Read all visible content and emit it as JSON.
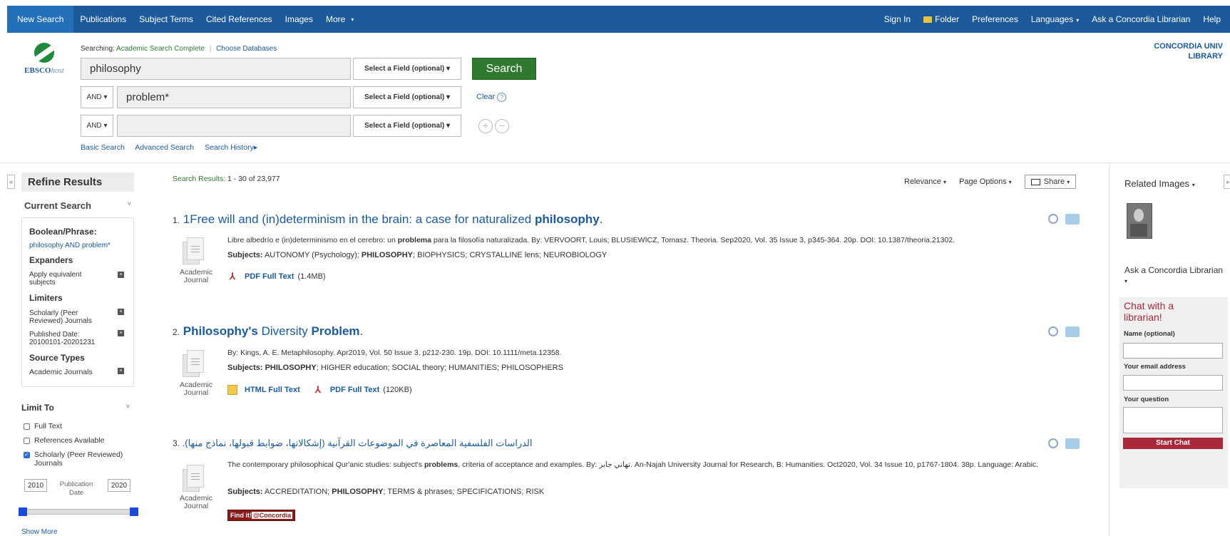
{
  "topnav": {
    "left": [
      "New Search",
      "Publications",
      "Subject Terms",
      "Cited References",
      "Images",
      "More"
    ],
    "right": {
      "sign_in": "Sign In",
      "folder": "Folder",
      "preferences": "Preferences",
      "languages": "Languages",
      "ask": "Ask a Concordia Librarian",
      "help": "Help"
    }
  },
  "logo": {
    "brand": "EBSCO",
    "suffix": "host"
  },
  "search": {
    "searching_label": "Searching:",
    "database": "Academic Search Complete",
    "choose_db": "Choose Databases",
    "q1": "philosophy",
    "q2": "problem*",
    "q3": "",
    "bool2": "AND",
    "bool3": "AND",
    "field": "Select a Field (optional)",
    "search_btn": "Search",
    "clear": "Clear",
    "links": [
      "Basic Search",
      "Advanced Search",
      "Search History"
    ]
  },
  "library": {
    "line1": "CONCORDIA UNIV",
    "line2": "LIBRARY"
  },
  "refine": {
    "title": "Refine Results",
    "current_search": "Current Search",
    "boolean_h": "Boolean/Phrase:",
    "boolean_val": "philosophy AND problem*",
    "expanders_h": "Expanders",
    "expander1": "Apply equivalent subjects",
    "limiters_h": "Limiters",
    "limiter1": "Scholarly (Peer Reviewed) Journals",
    "limiter2": "Published Date: 20100101-20201231",
    "source_h": "Source Types",
    "source1": "Academic Journals",
    "limit_to": "Limit To",
    "chk_full": "Full Text",
    "chk_refs": "References Available",
    "chk_scholarly": "Scholarly (Peer Reviewed) Journals",
    "year_from": "2010",
    "year_to": "2020",
    "pub_date": "Publication Date",
    "show_more": "Show More"
  },
  "results": {
    "summary_label": "Search Results:",
    "summary": "1 - 30 of 23,977",
    "relevance": "Relevance",
    "page_options": "Page Options",
    "share": "Share",
    "items": [
      {
        "num": "1.",
        "title_pre": "1Free will and (in)determinism in the brain: a case for naturalized ",
        "title_bold": "philosophy",
        "title_post": ".",
        "desc_pre": "Libre albedrío e (in)determinismo en el cerebro: un ",
        "desc_bold": "problema",
        "desc_post": " para la filosofía naturalizada. By: VERVOORT, Louis; BLUSIEWICZ, Tomasz. Theoria. Sep2020, Vol. 35 Issue 3, p345-364. 20p. DOI: 10.1387/theoria.21302.",
        "subjects_label": "Subjects:",
        "subjects_pre": "AUTONOMY (Psychology); ",
        "subjects_bold": "PHILOSOPHY",
        "subjects_post": "; BIOPHYSICS; CRYSTALLINE lens; NEUROBIOLOGY",
        "type": "Academic Journal",
        "pdf": "PDF Full Text",
        "pdf_size": "(1.4MB)"
      },
      {
        "num": "2.",
        "title_bold1": "Philosophy's",
        "title_mid": " Diversity ",
        "title_bold2": "Problem",
        "title_post": ".",
        "desc": "By: Kings, A. E. Metaphilosophy. Apr2019, Vol. 50 Issue 3, p212-230. 19p. DOI: 10.1111/meta.12358.",
        "subjects_label": "Subjects:",
        "subjects_bold": "PHILOSOPHY",
        "subjects_post": "; HIGHER education; SOCIAL theory; HUMANITIES; PHILOSOPHERS",
        "type": "Academic Journal",
        "html": "HTML Full Text",
        "pdf": "PDF Full Text",
        "pdf_size": "(120KB)"
      },
      {
        "num": "3.",
        "title": "الدراسات الفلسفية المعاصرة في الموضوعات القرآنية (إشكالاتها، ضوابط قبولها، نماذج منها).",
        "desc_pre": "The contemporary philosophical Qur'anic studies: subject's ",
        "desc_bold": "problems",
        "desc_post": ", criteria of acceptance and examples. By: تهاني جابر. An-Najah University Journal for Research, B: Humanities. Oct2020, Vol. 34 Issue 10, p1767-1804. 38p. Language: Arabic.",
        "subjects_label": "Subjects:",
        "subjects_pre": "ACCREDITATION; ",
        "subjects_bold": "PHILOSOPHY",
        "subjects_post": "; TERMS & phrases; SPECIFICATIONS; RISK",
        "type": "Academic Journal",
        "findit": "Find it!",
        "findit_at": "@Concordia"
      }
    ]
  },
  "sidebar": {
    "related_images": "Related Images",
    "ask_title": "Ask a Concordia Librarian",
    "chat_title": "Chat with a librarian!",
    "name_label": "Name (optional)",
    "email_label": "Your email address",
    "question_label": "Your question",
    "start_chat": "Start Chat"
  }
}
